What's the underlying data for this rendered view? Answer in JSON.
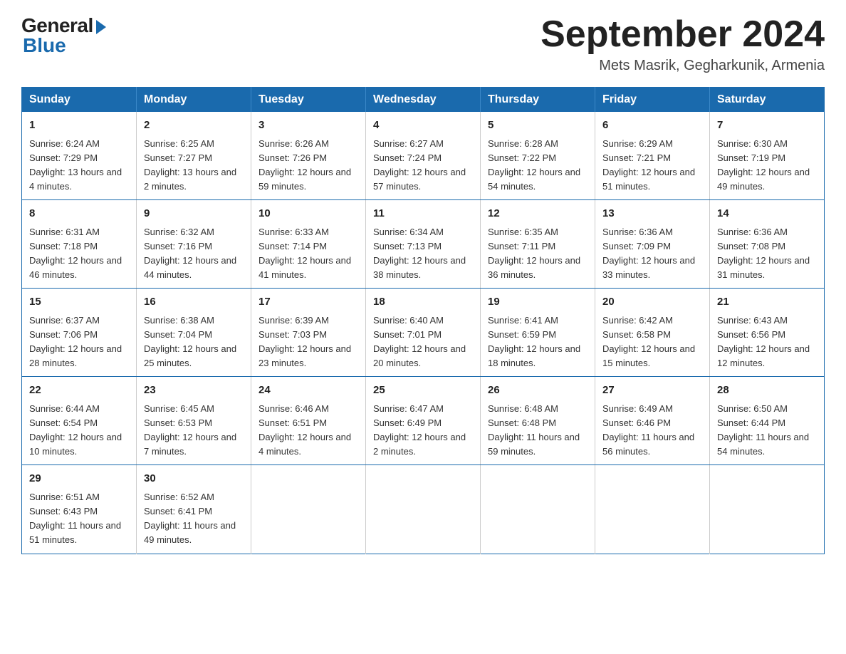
{
  "logo": {
    "general": "General",
    "blue": "Blue"
  },
  "title": {
    "month_year": "September 2024",
    "location": "Mets Masrik, Gegharkunik, Armenia"
  },
  "weekdays": [
    "Sunday",
    "Monday",
    "Tuesday",
    "Wednesday",
    "Thursday",
    "Friday",
    "Saturday"
  ],
  "weeks": [
    [
      {
        "day": "1",
        "sunrise": "6:24 AM",
        "sunset": "7:29 PM",
        "daylight": "13 hours and 4 minutes."
      },
      {
        "day": "2",
        "sunrise": "6:25 AM",
        "sunset": "7:27 PM",
        "daylight": "13 hours and 2 minutes."
      },
      {
        "day": "3",
        "sunrise": "6:26 AM",
        "sunset": "7:26 PM",
        "daylight": "12 hours and 59 minutes."
      },
      {
        "day": "4",
        "sunrise": "6:27 AM",
        "sunset": "7:24 PM",
        "daylight": "12 hours and 57 minutes."
      },
      {
        "day": "5",
        "sunrise": "6:28 AM",
        "sunset": "7:22 PM",
        "daylight": "12 hours and 54 minutes."
      },
      {
        "day": "6",
        "sunrise": "6:29 AM",
        "sunset": "7:21 PM",
        "daylight": "12 hours and 51 minutes."
      },
      {
        "day": "7",
        "sunrise": "6:30 AM",
        "sunset": "7:19 PM",
        "daylight": "12 hours and 49 minutes."
      }
    ],
    [
      {
        "day": "8",
        "sunrise": "6:31 AM",
        "sunset": "7:18 PM",
        "daylight": "12 hours and 46 minutes."
      },
      {
        "day": "9",
        "sunrise": "6:32 AM",
        "sunset": "7:16 PM",
        "daylight": "12 hours and 44 minutes."
      },
      {
        "day": "10",
        "sunrise": "6:33 AM",
        "sunset": "7:14 PM",
        "daylight": "12 hours and 41 minutes."
      },
      {
        "day": "11",
        "sunrise": "6:34 AM",
        "sunset": "7:13 PM",
        "daylight": "12 hours and 38 minutes."
      },
      {
        "day": "12",
        "sunrise": "6:35 AM",
        "sunset": "7:11 PM",
        "daylight": "12 hours and 36 minutes."
      },
      {
        "day": "13",
        "sunrise": "6:36 AM",
        "sunset": "7:09 PM",
        "daylight": "12 hours and 33 minutes."
      },
      {
        "day": "14",
        "sunrise": "6:36 AM",
        "sunset": "7:08 PM",
        "daylight": "12 hours and 31 minutes."
      }
    ],
    [
      {
        "day": "15",
        "sunrise": "6:37 AM",
        "sunset": "7:06 PM",
        "daylight": "12 hours and 28 minutes."
      },
      {
        "day": "16",
        "sunrise": "6:38 AM",
        "sunset": "7:04 PM",
        "daylight": "12 hours and 25 minutes."
      },
      {
        "day": "17",
        "sunrise": "6:39 AM",
        "sunset": "7:03 PM",
        "daylight": "12 hours and 23 minutes."
      },
      {
        "day": "18",
        "sunrise": "6:40 AM",
        "sunset": "7:01 PM",
        "daylight": "12 hours and 20 minutes."
      },
      {
        "day": "19",
        "sunrise": "6:41 AM",
        "sunset": "6:59 PM",
        "daylight": "12 hours and 18 minutes."
      },
      {
        "day": "20",
        "sunrise": "6:42 AM",
        "sunset": "6:58 PM",
        "daylight": "12 hours and 15 minutes."
      },
      {
        "day": "21",
        "sunrise": "6:43 AM",
        "sunset": "6:56 PM",
        "daylight": "12 hours and 12 minutes."
      }
    ],
    [
      {
        "day": "22",
        "sunrise": "6:44 AM",
        "sunset": "6:54 PM",
        "daylight": "12 hours and 10 minutes."
      },
      {
        "day": "23",
        "sunrise": "6:45 AM",
        "sunset": "6:53 PM",
        "daylight": "12 hours and 7 minutes."
      },
      {
        "day": "24",
        "sunrise": "6:46 AM",
        "sunset": "6:51 PM",
        "daylight": "12 hours and 4 minutes."
      },
      {
        "day": "25",
        "sunrise": "6:47 AM",
        "sunset": "6:49 PM",
        "daylight": "12 hours and 2 minutes."
      },
      {
        "day": "26",
        "sunrise": "6:48 AM",
        "sunset": "6:48 PM",
        "daylight": "11 hours and 59 minutes."
      },
      {
        "day": "27",
        "sunrise": "6:49 AM",
        "sunset": "6:46 PM",
        "daylight": "11 hours and 56 minutes."
      },
      {
        "day": "28",
        "sunrise": "6:50 AM",
        "sunset": "6:44 PM",
        "daylight": "11 hours and 54 minutes."
      }
    ],
    [
      {
        "day": "29",
        "sunrise": "6:51 AM",
        "sunset": "6:43 PM",
        "daylight": "11 hours and 51 minutes."
      },
      {
        "day": "30",
        "sunrise": "6:52 AM",
        "sunset": "6:41 PM",
        "daylight": "11 hours and 49 minutes."
      },
      null,
      null,
      null,
      null,
      null
    ]
  ]
}
